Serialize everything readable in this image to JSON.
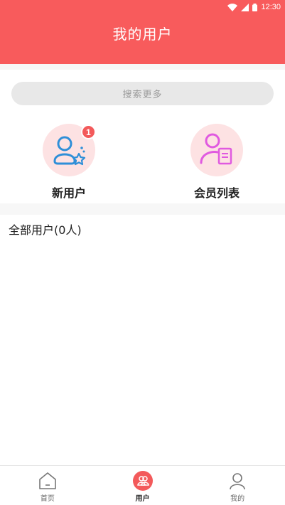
{
  "status_bar": {
    "time": "12:30"
  },
  "header": {
    "title": "我的用户"
  },
  "search": {
    "placeholder": "搜索更多"
  },
  "entries": [
    {
      "label": "新用户",
      "badge": "1",
      "icon": "new-user-icon"
    },
    {
      "label": "会员列表",
      "icon": "member-list-icon"
    }
  ],
  "section": {
    "all_users": "全部用户(0人)"
  },
  "tabbar": {
    "items": [
      {
        "label": "首页",
        "icon": "home-icon",
        "active": false
      },
      {
        "label": "用户",
        "icon": "users-icon",
        "active": true
      },
      {
        "label": "我的",
        "icon": "profile-icon",
        "active": false
      }
    ]
  },
  "colors": {
    "brand": "#f85b5c",
    "icon_blue": "#2f8fd8",
    "icon_pink": "#e05ae0",
    "icon_bg": "#fde2e3"
  }
}
